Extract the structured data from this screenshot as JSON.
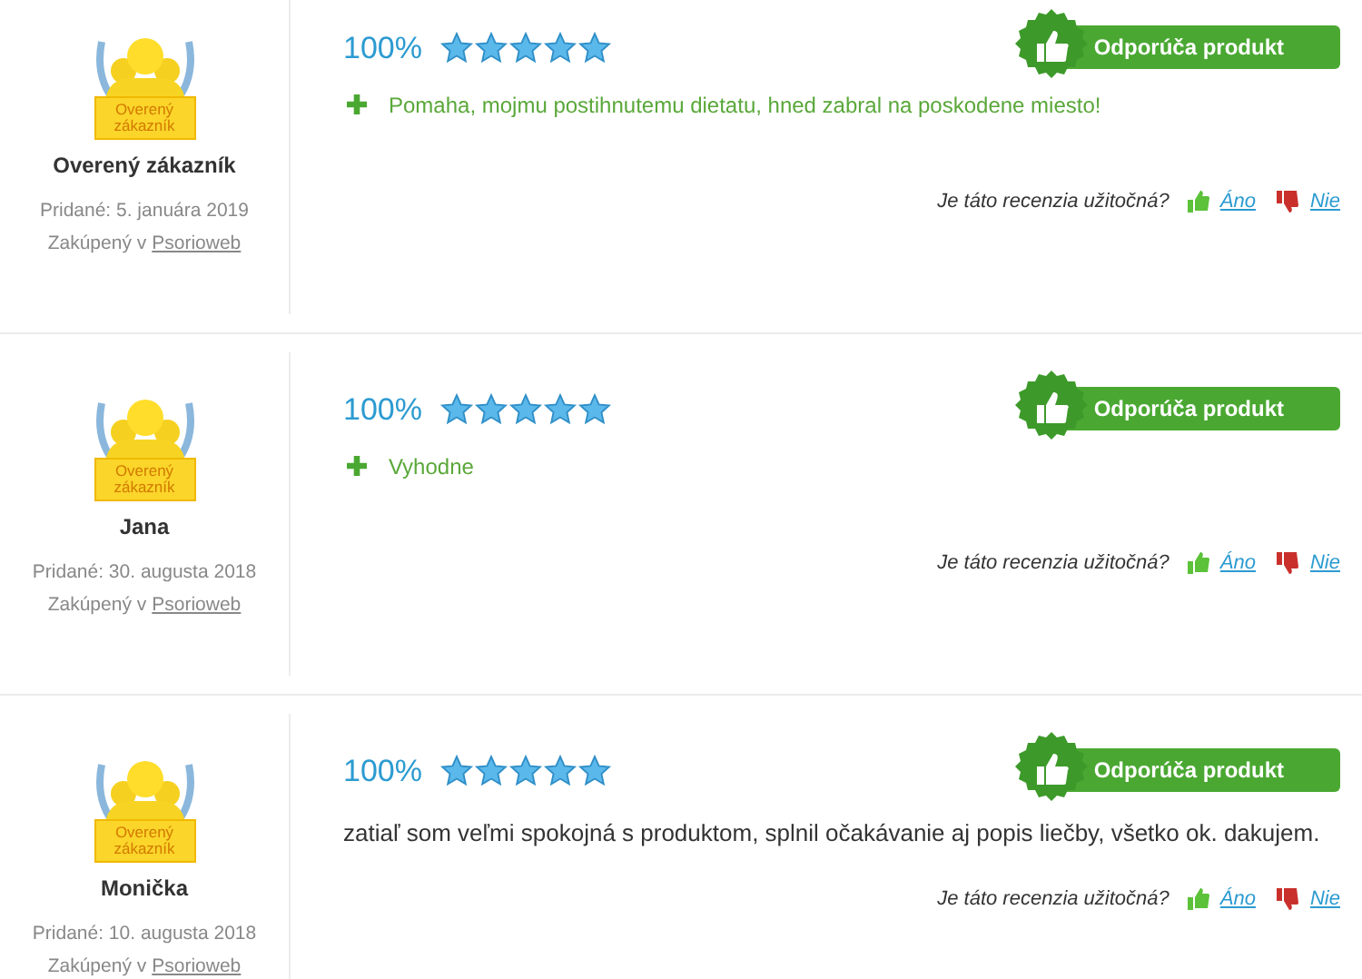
{
  "reviews": [
    {
      "badge_text": "Overený zákazník",
      "author": "Overený zákazník",
      "added": "Pridané: 5. januára 2019",
      "bought_prefix": "Zakúpený v",
      "shop": "Psorioweb",
      "percent": "100%",
      "stars": 5,
      "recommend": "Odporúča produkt",
      "kind": "pro",
      "text": "Pomaha, mojmu postihnutemu dietatu, hned zabral na poskodene miesto!",
      "helpful_question": "Je táto recenzia užitočná?",
      "yes": "Áno",
      "no": "Nie"
    },
    {
      "badge_text": "Overený zákazník",
      "author": "Jana",
      "added": "Pridané: 30. augusta 2018",
      "bought_prefix": "Zakúpený v",
      "shop": "Psorioweb",
      "percent": "100%",
      "stars": 5,
      "recommend": "Odporúča produkt",
      "kind": "pro",
      "text": "Vyhodne",
      "helpful_question": "Je táto recenzia užitočná?",
      "yes": "Áno",
      "no": "Nie"
    },
    {
      "badge_text": "Overený zákazník",
      "author": "Monička",
      "added": "Pridané: 10. augusta 2018",
      "bought_prefix": "Zakúpený v",
      "shop": "Psorioweb",
      "percent": "100%",
      "stars": 5,
      "recommend": "Odporúča produkt",
      "kind": "plain",
      "text": "zatiaľ som veľmi spokojná s produktom, splnil očakávanie aj popis liečby, všetko ok. dakujem.",
      "helpful_question": "Je táto recenzia užitočná?",
      "yes": "Áno",
      "no": "Nie"
    }
  ]
}
